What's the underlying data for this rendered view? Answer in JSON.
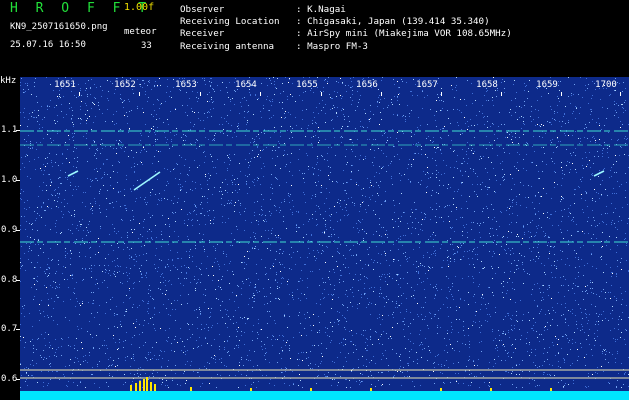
{
  "header": {
    "app_title": "H R O F F T",
    "version": "1.00f",
    "filename": "KN9_2507161650.png",
    "mode": "meteor",
    "datetime": "25.07.16 16:50",
    "count": "33"
  },
  "info": [
    {
      "key": "Observer",
      "value": ": K.Nagai"
    },
    {
      "key": "Receiving Location",
      "value": ": Chigasaki, Japan (139.414 35.340)"
    },
    {
      "key": "Receiver",
      "value": ": AirSpy mini (Miakejima VOR 108.65MHz)"
    },
    {
      "key": "Receiving antenna",
      "value": ": Maspro FM-3"
    }
  ],
  "axes": {
    "y_unit": "kHz",
    "y_labels": [
      "1.1",
      "1.0",
      "0.9",
      "0.8",
      "0.7",
      "0.6"
    ],
    "y_values": [
      1.1,
      1.0,
      0.9,
      0.8,
      0.7,
      0.6
    ],
    "x_labels": [
      "1651",
      "1652",
      "1653",
      "1654",
      "1655",
      "1656",
      "1657",
      "1658",
      "1659",
      "1700"
    ]
  },
  "colors": {
    "background": "#0d2a8a",
    "trace": "#40e0d0",
    "bottom_band": "#00e5ff",
    "title": "#22e03a",
    "version": "#f0e000"
  }
}
